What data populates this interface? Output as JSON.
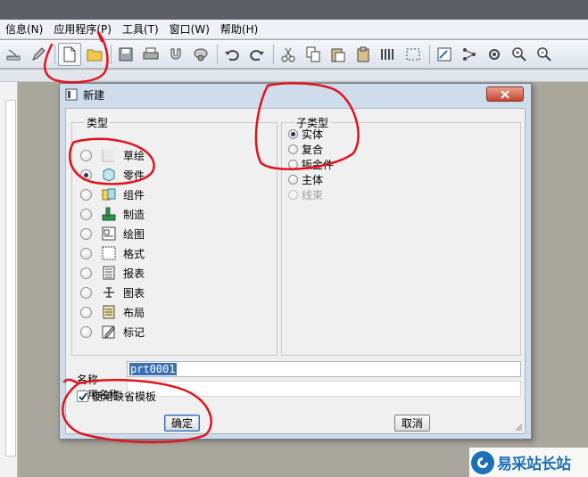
{
  "menubar": {
    "items": [
      "信息(N)",
      "应用程序(P)",
      "工具(T)",
      "窗口(W)",
      "帮助(H)"
    ]
  },
  "toolbar": {
    "icons": [
      "ruler-icon",
      "pen-icon",
      "new-file-icon",
      "open-folder-icon",
      "save-icon",
      "print-icon",
      "magnet-icon",
      "disk-icon",
      "undo-icon",
      "redo-icon",
      "scissors-icon",
      "copy-icon",
      "paste-icon",
      "paste-special-icon",
      "layers-icon",
      "select-box-icon",
      "sketch-icon",
      "connect-icon",
      "settings-icon",
      "zoom-in-icon",
      "zoom-out-icon"
    ]
  },
  "dialog": {
    "title": "新建",
    "type_group_label": "类型",
    "type_options": [
      {
        "label": "草绘",
        "icon": "sketch-icon",
        "checked": false
      },
      {
        "label": "零件",
        "icon": "part-icon",
        "checked": true
      },
      {
        "label": "组件",
        "icon": "assembly-icon",
        "checked": false
      },
      {
        "label": "制造",
        "icon": "manufacture-icon",
        "checked": false
      },
      {
        "label": "绘图",
        "icon": "drawing-icon",
        "checked": false
      },
      {
        "label": "格式",
        "icon": "format-icon",
        "checked": false
      },
      {
        "label": "报表",
        "icon": "report-icon",
        "checked": false
      },
      {
        "label": "图表",
        "icon": "diagram-icon",
        "checked": false
      },
      {
        "label": "布局",
        "icon": "layout-icon",
        "checked": false
      },
      {
        "label": "标记",
        "icon": "markup-icon",
        "checked": false
      }
    ],
    "subtype_group_label": "子类型",
    "subtype_options": [
      {
        "label": "实体",
        "checked": true,
        "disabled": false
      },
      {
        "label": "复合",
        "checked": false,
        "disabled": false
      },
      {
        "label": "钣金件",
        "checked": false,
        "disabled": false
      },
      {
        "label": "主体",
        "checked": false,
        "disabled": false
      },
      {
        "label": "线束",
        "checked": false,
        "disabled": true
      }
    ],
    "name_label": "名称",
    "name_value": "prt0001",
    "common_name_label": "公用名称",
    "common_name_value": "",
    "use_default_template_label": "使用缺省模板",
    "use_default_template_checked": true,
    "ok_label": "确定",
    "cancel_label": "取消"
  },
  "watermark": {
    "text": "易采站长站"
  },
  "colors": {
    "annotation": "#e0141e",
    "accent": "#1d6fb8"
  }
}
